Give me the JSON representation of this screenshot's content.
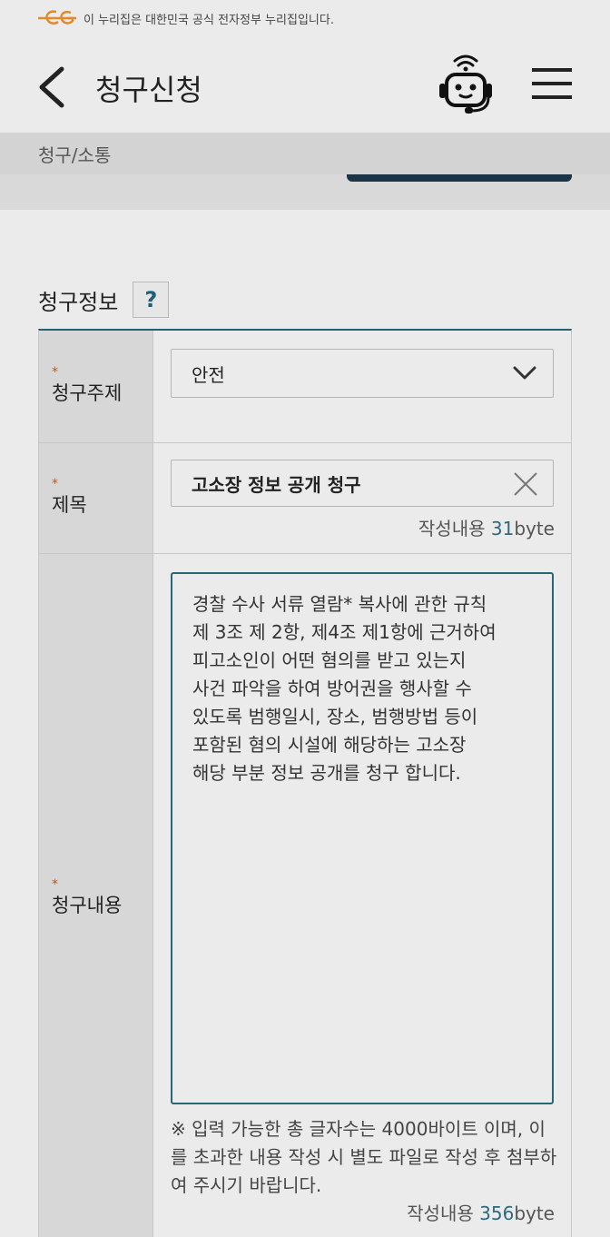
{
  "gov_banner": {
    "text": "이 누리집은 대한민국 공식 전자정부 누리집입니다."
  },
  "header": {
    "title": "청구신청"
  },
  "breadcrumb": "청구/소통",
  "section": {
    "title": "청구정보",
    "help_label": "?"
  },
  "form": {
    "topic": {
      "label": "청구주제",
      "value": "안전"
    },
    "subject": {
      "label": "제목",
      "value": "고소장 정보 공개 청구",
      "byte_prefix": "작성내용 ",
      "byte_value": "31",
      "byte_suffix": "byte"
    },
    "content": {
      "label": "청구내용",
      "value": "경찰 수사 서류 열람* 복사에 관한 규칙\n제 3조 제 2항, 제4조 제1항에 근거하여\n피고소인이 어떤 혐의를 받고 있는지\n사건 파악을 하여 방어권을 행사할 수\n있도록 범행일시, 장소, 범행방법 등이\n포함된 혐의 시설에 해당하는 고소장\n해당 부분  정보 공개를 청구 합니다.",
      "notice": "※ 입력 가능한 총 글자수는 4000바이트 이며, 이를 초과한 내용 작성 시 별도 파일로 작성 후 첨부하여 주시기 바랍니다.",
      "byte_prefix": "작성내용 ",
      "byte_value": "356",
      "byte_suffix": "byte"
    },
    "required_mark": "*"
  },
  "colors": {
    "accent": "#2c6676",
    "required": "#c0571d",
    "logo": "#e08a2c"
  }
}
